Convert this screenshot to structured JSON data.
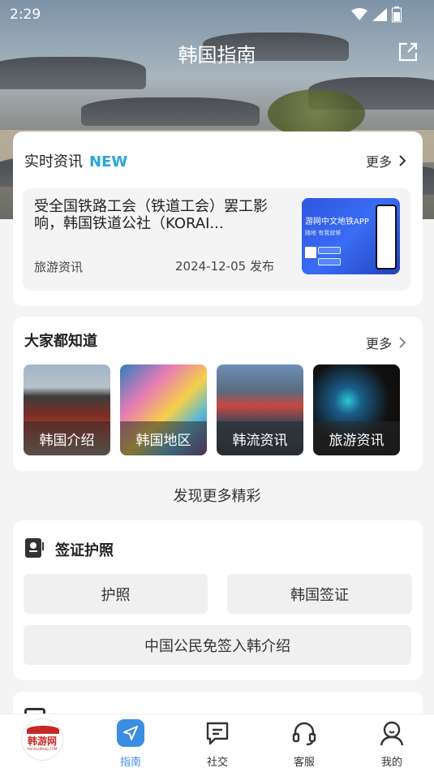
{
  "status": {
    "time": "2:29"
  },
  "header": {
    "title": "韩国指南"
  },
  "news_section": {
    "title": "实时资讯",
    "badge": "NEW",
    "more": "更多",
    "item": {
      "title": "受全国铁路工会（铁道工会）罢工影响，韩国铁道公社（KORAI...",
      "category": "旅游资讯",
      "date": "2024-12-05 发布",
      "thumb_line1": "游网中文地铁APP",
      "thumb_line2": "随地 有我就够"
    }
  },
  "know_section": {
    "title": "大家都知道",
    "more": "更多",
    "tiles": [
      {
        "label": "韩国介绍"
      },
      {
        "label": "韩国地区"
      },
      {
        "label": "韩流资讯"
      },
      {
        "label": "旅游资讯"
      }
    ]
  },
  "discover": "发现更多精彩",
  "visa_section": {
    "title": "签证护照",
    "buttons": [
      "护照",
      "韩国签证",
      "中国公民免签入韩介绍"
    ]
  },
  "tabbar": {
    "logo_text": "韩游网",
    "logo_sub": "HanYouWang.COM",
    "tabs": [
      {
        "label": "指南",
        "icon": "navigate-icon",
        "active": true
      },
      {
        "label": "社交",
        "icon": "chat-icon"
      },
      {
        "label": "客服",
        "icon": "headset-icon"
      },
      {
        "label": "我的",
        "icon": "user-icon"
      }
    ]
  },
  "colors": {
    "accent": "#3a8de0",
    "new_badge": "#2aa6d9",
    "logo_red": "#c62828"
  }
}
